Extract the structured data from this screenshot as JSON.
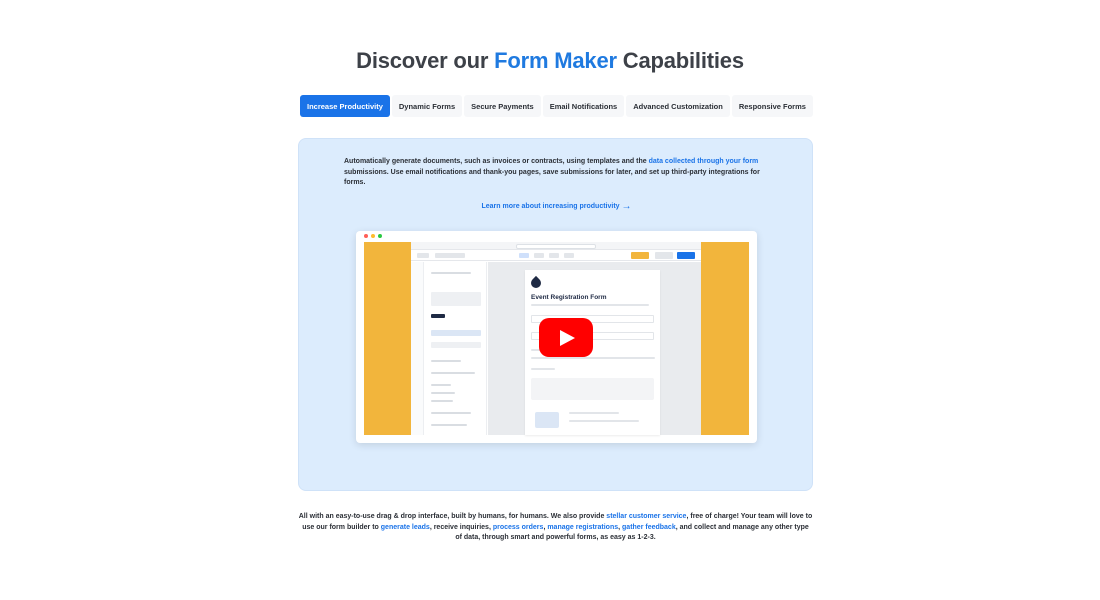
{
  "headline": {
    "part1": "Discover our ",
    "accent": "Form Maker",
    "part2": " Capabilities"
  },
  "colors": {
    "accent": "#1f7ae0",
    "tab_active_bg": "#1a73e8",
    "panel_bg": "#dcecfd",
    "video_stage": "#f2b53c",
    "play_button": "#ff0000"
  },
  "tabs": [
    {
      "label": "Increase Productivity",
      "active": true
    },
    {
      "label": "Dynamic Forms",
      "active": false
    },
    {
      "label": "Secure Payments",
      "active": false
    },
    {
      "label": "Email Notifications",
      "active": false
    },
    {
      "label": "Advanced Customization",
      "active": false
    },
    {
      "label": "Responsive Forms",
      "active": false
    }
  ],
  "panel": {
    "text_before": "Automatically generate documents, such as invoices or contracts, using templates and the ",
    "text_link": "data collected through your form",
    "text_after": " submissions. Use email notifications and thank-you pages, save submissions for later, and set up third-party integrations for forms.",
    "learn_more": "Learn more about increasing productivity",
    "learn_more_icon": "arrow-right-icon"
  },
  "video": {
    "form_title": "Event Registration Form",
    "play_icon": "youtube-play-icon"
  },
  "footer": {
    "t1": "All with an easy-to-use drag & drop interface, built by humans, for humans. We also provide ",
    "l1": "stellar customer service",
    "t2": ", free of charge! Your team will love to use our form builder to ",
    "l2": "generate leads",
    "t3": ", receive inquiries, ",
    "l3": "process orders",
    "t4": ", ",
    "l4": "manage registrations",
    "t5": ", ",
    "l5": "gather feedback",
    "t6": ", and collect and manage any other type of data, through smart and powerful forms, as easy as 1-2-3."
  }
}
